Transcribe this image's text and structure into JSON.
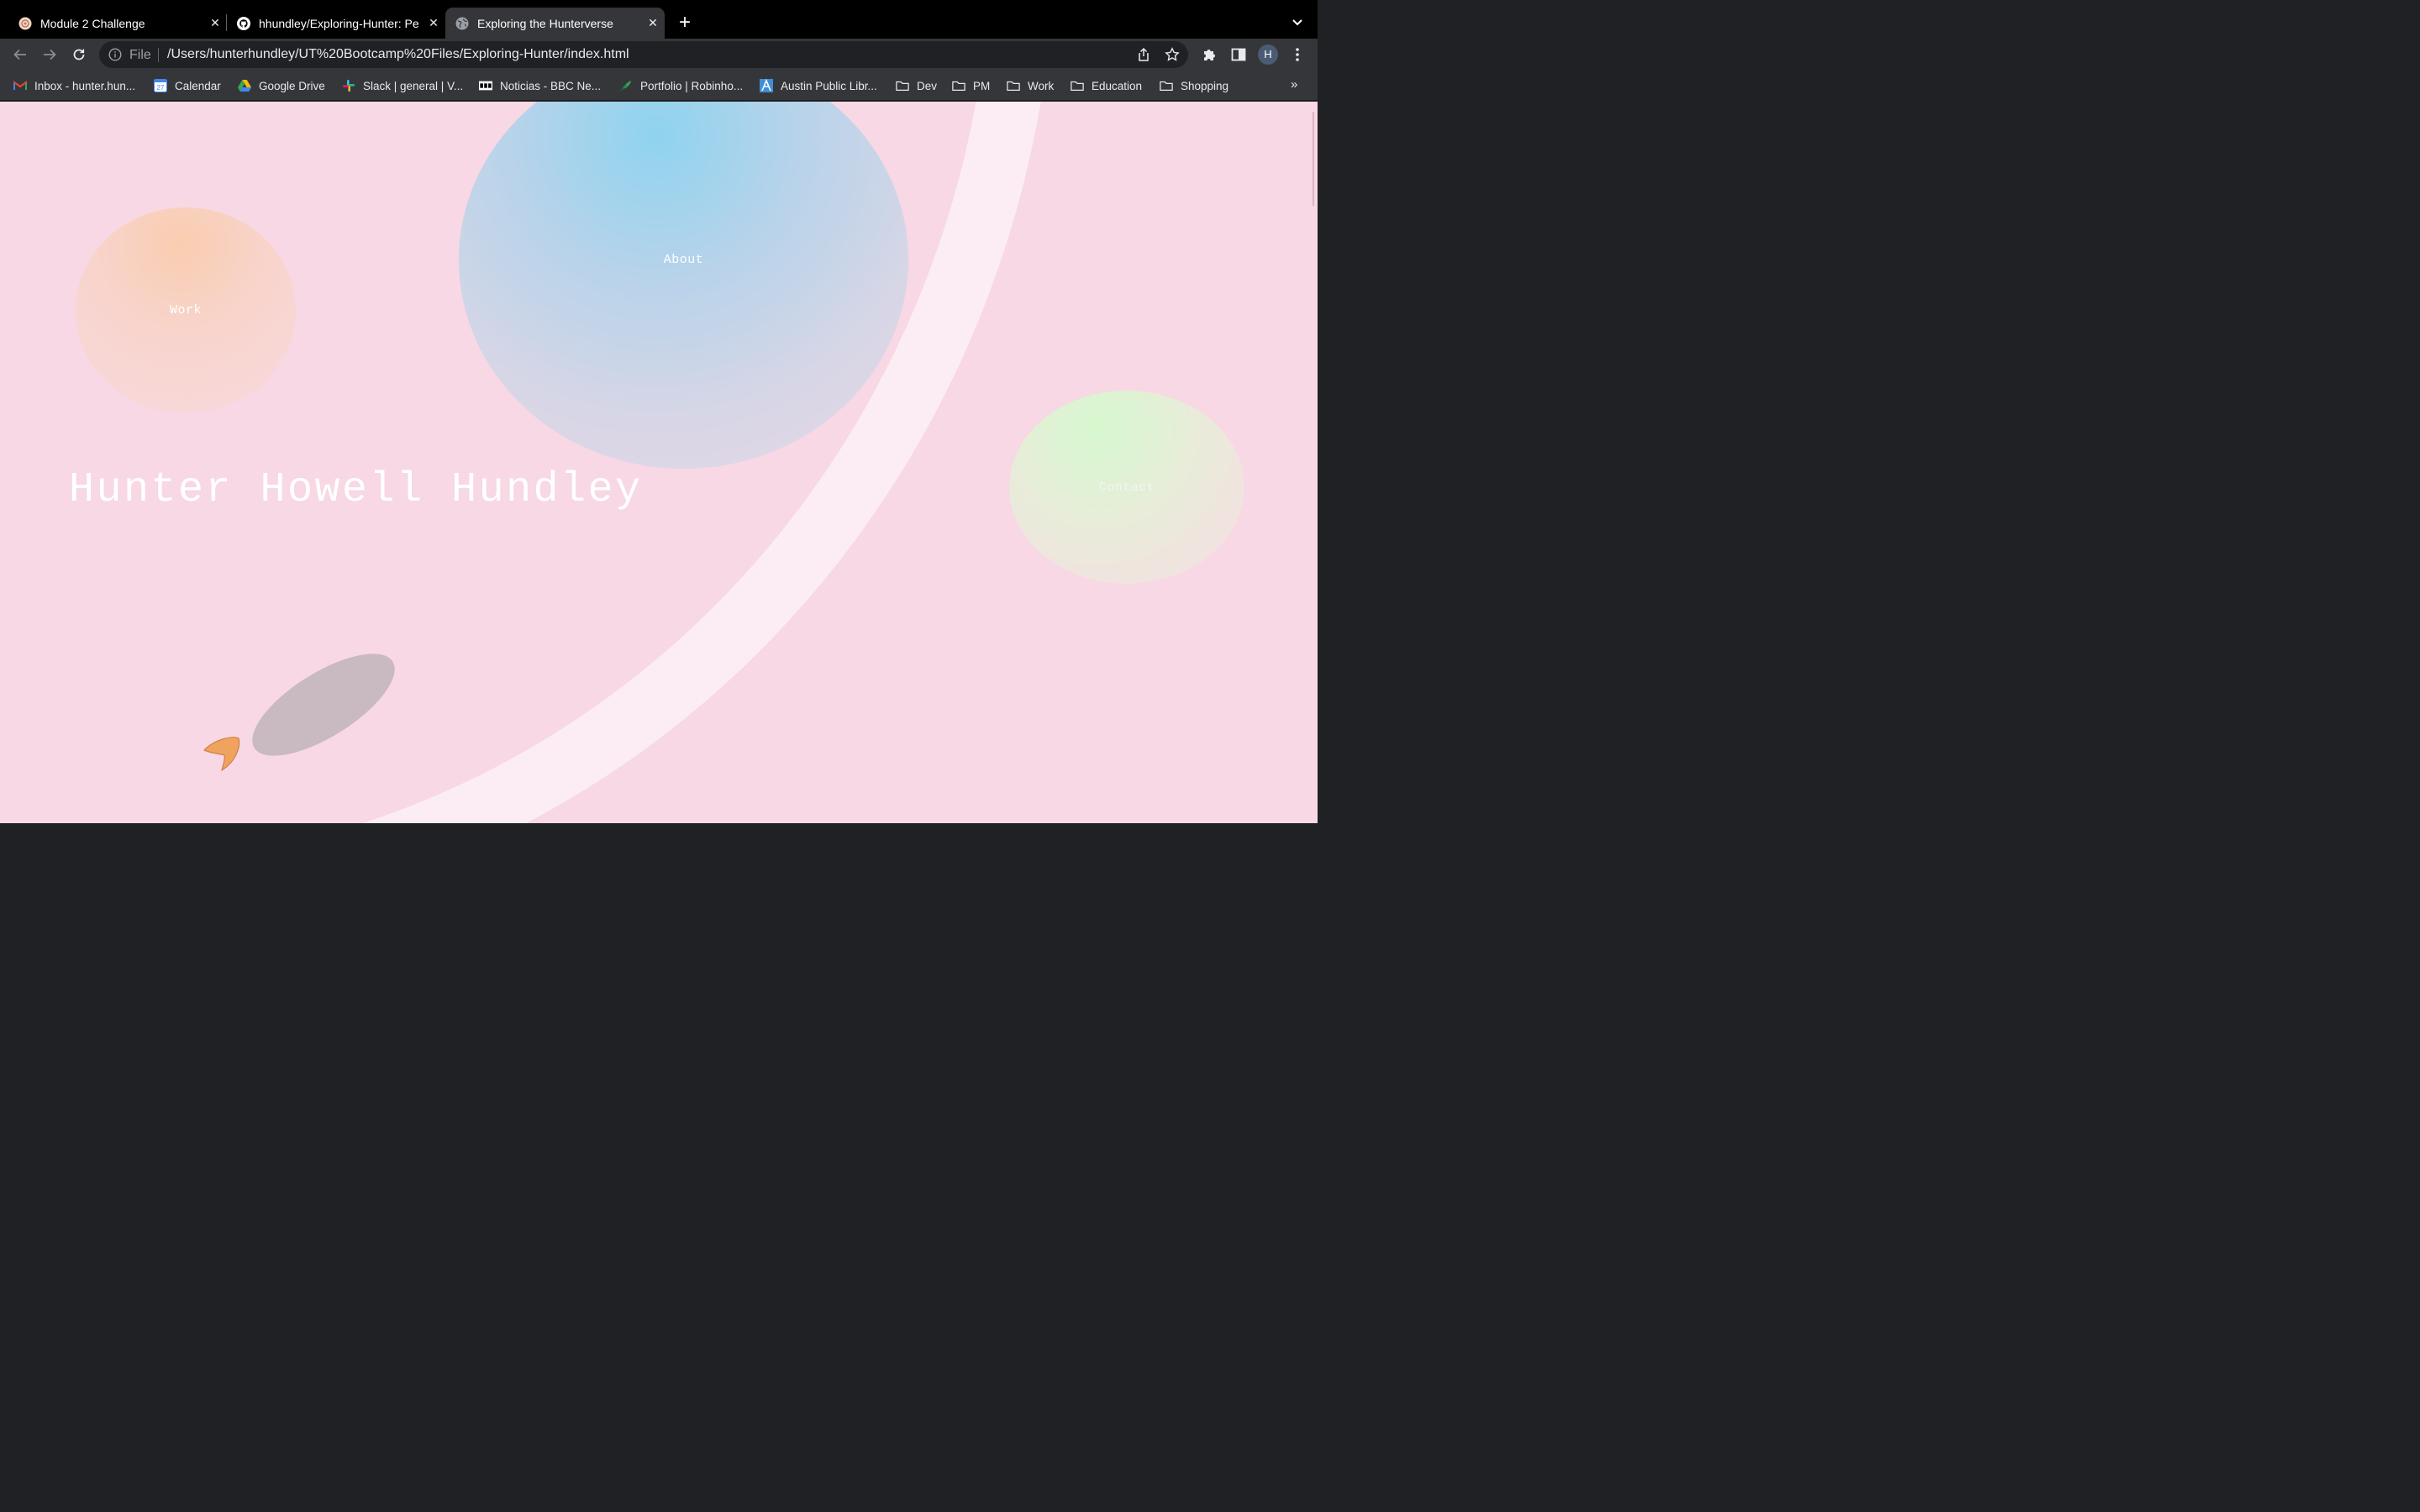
{
  "browser": {
    "tabs": [
      {
        "title": "Module 2 Challenge",
        "icon": "module-favicon-icon",
        "active": false
      },
      {
        "title": "hhundley/Exploring-Hunter: Pe",
        "icon": "github-icon",
        "active": false
      },
      {
        "title": "Exploring the Hunterverse",
        "icon": "globe-icon",
        "active": true
      }
    ],
    "address": {
      "scheme": "File",
      "url": "/Users/hunterhundley/UT%20Bootcamp%20Files/Exploring-Hunter/index.html"
    },
    "profile_initial": "H",
    "bookmarks": [
      {
        "label": "Inbox - hunter.hun...",
        "icon": "gmail-icon"
      },
      {
        "label": "Calendar",
        "icon": "calendar-icon"
      },
      {
        "label": "Google Drive",
        "icon": "drive-icon"
      },
      {
        "label": "Slack | general | V...",
        "icon": "slack-icon"
      },
      {
        "label": "Noticias - BBC Ne...",
        "icon": "bbc-icon"
      },
      {
        "label": "Portfolio | Robinho...",
        "icon": "feather-icon"
      },
      {
        "label": "Austin Public Libr...",
        "icon": "library-icon"
      },
      {
        "label": "Dev",
        "icon": "folder-icon"
      },
      {
        "label": "PM",
        "icon": "folder-icon"
      },
      {
        "label": "Work",
        "icon": "folder-icon"
      },
      {
        "label": "Education",
        "icon": "folder-icon"
      },
      {
        "label": "Shopping",
        "icon": "folder-icon"
      }
    ],
    "bookmarks_more": "»"
  },
  "page": {
    "planets": {
      "work": "Work",
      "about": "About",
      "contact": "Contact"
    },
    "name": "Hunter Howell Hundley"
  },
  "colors": {
    "background": "#f7d8e4",
    "ring": "#fbeef2",
    "work_planet": "#f9cdb0",
    "about_planet": "#8fd3ef",
    "contact_planet": "#d6f8cf",
    "rocket_body": "#c9b9c0",
    "rocket_flame": "#f0a35e"
  }
}
